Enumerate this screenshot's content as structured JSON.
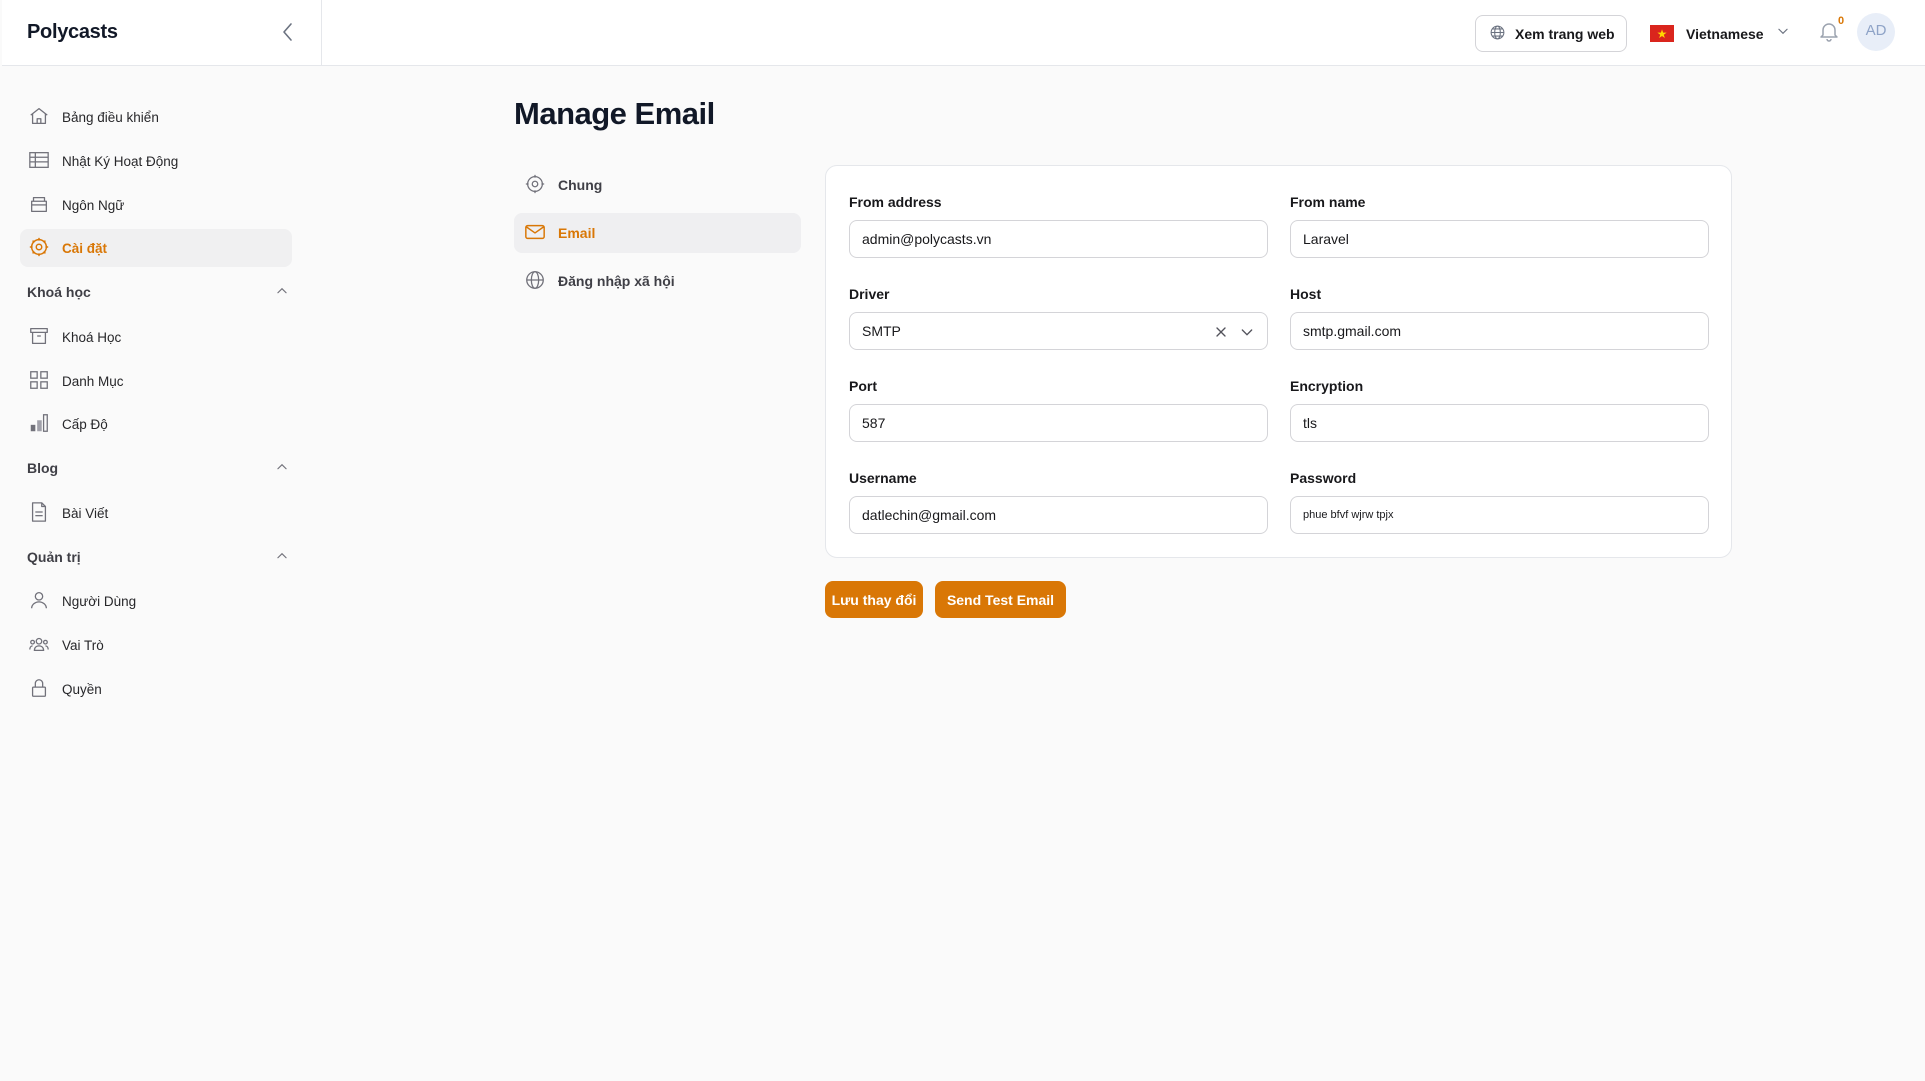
{
  "app": {
    "brand": "Polycasts"
  },
  "topbar": {
    "view_site_label": "Xem trang web",
    "language_label": "Vietnamese",
    "notification_count": "0",
    "avatar_initials": "AD"
  },
  "sidebar": {
    "top_items": [
      {
        "label": "Bảng điều khiển",
        "icon": "home-icon"
      },
      {
        "label": "Nhật Ký Hoạt Động",
        "icon": "table-icon"
      },
      {
        "label": "Ngôn Ngữ",
        "icon": "archive-icon"
      },
      {
        "label": "Cài đặt",
        "icon": "gear-icon",
        "active": true
      }
    ],
    "groups": [
      {
        "label": "Khoá học",
        "items": [
          {
            "label": "Khoá Học",
            "icon": "archive-box-icon"
          },
          {
            "label": "Danh Mục",
            "icon": "grid-icon"
          },
          {
            "label": "Cấp Độ",
            "icon": "bar-chart-icon"
          }
        ]
      },
      {
        "label": "Blog",
        "items": [
          {
            "label": "Bài Viết",
            "icon": "document-icon"
          }
        ]
      },
      {
        "label": "Quản trị",
        "items": [
          {
            "label": "Người Dùng",
            "icon": "user-icon"
          },
          {
            "label": "Vai Trò",
            "icon": "users-group-icon"
          },
          {
            "label": "Quyền",
            "icon": "lock-icon"
          }
        ]
      }
    ]
  },
  "main": {
    "title": "Manage Email",
    "settings_nav": [
      {
        "label": "Chung",
        "icon": "gear-icon"
      },
      {
        "label": "Email",
        "icon": "envelope-icon",
        "active": true
      },
      {
        "label": "Đăng nhập xã hội",
        "icon": "globe-icon"
      }
    ],
    "form": {
      "from_address": {
        "label": "From address",
        "value": "admin@polycasts.vn"
      },
      "from_name": {
        "label": "From name",
        "value": "Laravel"
      },
      "driver": {
        "label": "Driver",
        "value": "SMTP"
      },
      "host": {
        "label": "Host",
        "value": "smtp.gmail.com"
      },
      "port": {
        "label": "Port",
        "value": "587"
      },
      "encryption": {
        "label": "Encryption",
        "value": "tls"
      },
      "username": {
        "label": "Username",
        "value": "datlechin@gmail.com"
      },
      "password": {
        "label": "Password",
        "value": "phue bfvf wjrw tpjx"
      }
    },
    "actions": {
      "save_label": "Lưu thay đổi",
      "test_label": "Send Test Email"
    }
  },
  "colors": {
    "accent": "#d97706",
    "sidebar_active_bg": "#f0f0f1",
    "page_bg": "#fafafa",
    "border": "#e5e7eb"
  }
}
